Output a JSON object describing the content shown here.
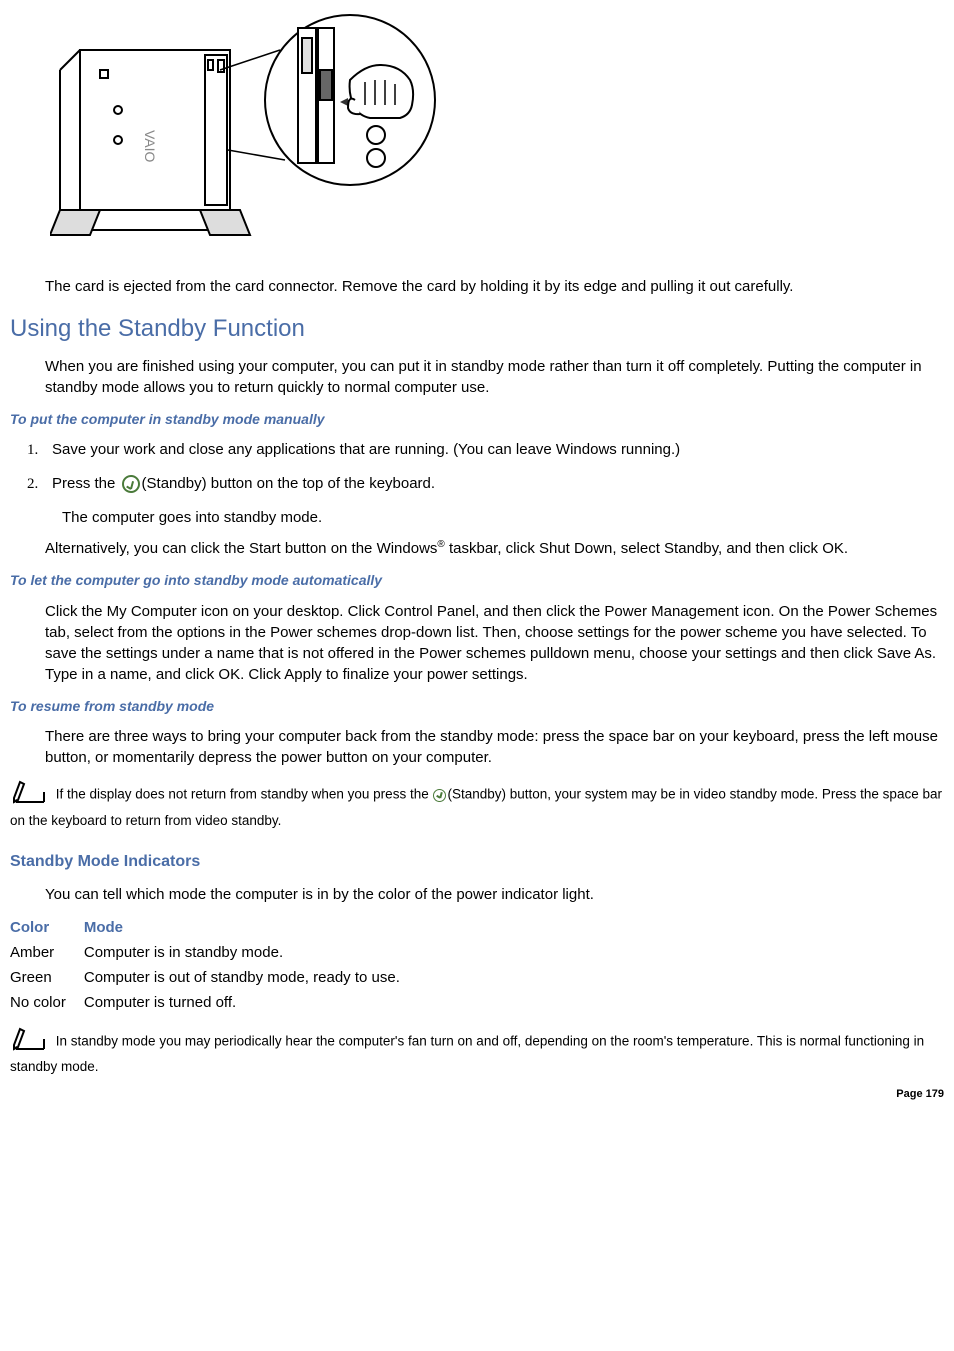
{
  "figure": {
    "alt": "Diagram of computer with zoomed inset showing hand pressing card eject button near PC card slot"
  },
  "eject_text": "The card is ejected from the card connector. Remove the card by holding it by its edge and pulling it out carefully.",
  "section_title": "Using the Standby Function",
  "intro_text": "When you are finished using your computer, you can put it in standby mode rather than turn it off completely. Putting the computer in standby mode allows you to return quickly to normal computer use.",
  "subsection_manual": "To put the computer in standby mode manually",
  "step1_text": "Save your work and close any applications that are running. (You can leave Windows running.)",
  "step2_prefix": "Press the ",
  "step2_suffix": "(Standby) button on the top of the keyboard.",
  "step2_result": "The computer goes into standby mode.",
  "alt_text_prefix": "Alternatively, you can click the Start button on the Windows",
  "registered": "®",
  "alt_text_suffix": " taskbar, click Shut Down, select Standby, and then click OK.",
  "subsection_auto": "To let the computer go into standby mode automatically",
  "auto_text": "Click the My Computer icon on your desktop. Click Control Panel, and then click the Power Management icon. On the Power Schemes tab, select from the options in the Power schemes drop-down list. Then, choose settings for the power scheme you have selected. To save the settings under a name that is not offered in the Power schemes pulldown menu, choose your settings and then click Save As. Type in a name, and click OK. Click Apply to finalize your power settings.",
  "subsection_resume": "To resume from standby mode",
  "resume_text": "There are three ways to bring your computer back from the standby mode: press the space bar on your keyboard, press the left mouse button, or momentarily depress the power button on your computer.",
  "note1_prefix": " If the display does not return from standby when you press the ",
  "note1_suffix": "(Standby) button, your system may be in video standby mode. Press the space bar on the keyboard to return from video standby.",
  "indicators_title": "Standby Mode Indicators",
  "indicators_intro": "You can tell which mode the computer is in by the color of the power indicator light.",
  "table": {
    "col1_header": "Color",
    "col2_header": "Mode",
    "rows": [
      {
        "color": "Amber",
        "mode": "Computer is in standby mode."
      },
      {
        "color": "Green",
        "mode": "Computer is out of standby mode, ready to use."
      },
      {
        "color": "No color",
        "mode": "Computer is turned off."
      }
    ]
  },
  "note2_text": " In standby mode you may periodically hear the computer's fan turn on and off, depending on the room's temperature. This is normal functioning in standby mode.",
  "page_number": "Page 179"
}
